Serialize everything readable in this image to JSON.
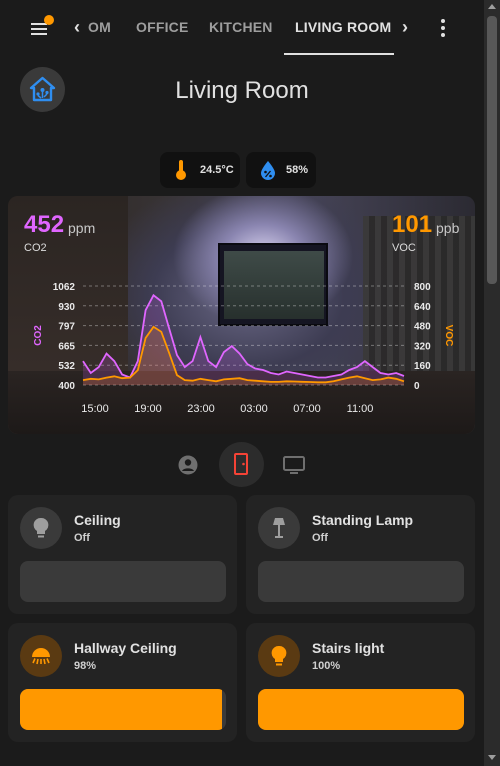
{
  "tabs": {
    "items": [
      {
        "label": "OM"
      },
      {
        "label": "OFFICE"
      },
      {
        "label": "KITCHEN"
      },
      {
        "label": "LIVING ROOM"
      }
    ]
  },
  "page": {
    "title": "Living Room"
  },
  "chips": {
    "temperature": "24.5°C",
    "humidity": "58%"
  },
  "sensors": {
    "co2_value": "452",
    "co2_unit": "ppm",
    "co2_label": "CO2",
    "voc_value": "101",
    "voc_unit": "ppb",
    "voc_label": "VOC"
  },
  "chart_data": {
    "type": "line",
    "x_ticks": [
      "15:00",
      "19:00",
      "23:00",
      "03:00",
      "07:00",
      "11:00"
    ],
    "y_left_ticks": [
      "1062",
      "930",
      "797",
      "665",
      "532",
      "400"
    ],
    "y_right_ticks": [
      "800",
      "640",
      "480",
      "320",
      "160",
      "0"
    ],
    "ylabel_left": "CO2",
    "ylabel_right": "VOC",
    "ylim_left": [
      400,
      1062
    ],
    "ylim_right": [
      0,
      800
    ],
    "series": [
      {
        "name": "CO2",
        "axis": "left",
        "color": "#e066ff",
        "values": [
          560,
          480,
          520,
          610,
          560,
          470,
          450,
          560,
          900,
          1000,
          960,
          780,
          600,
          520,
          560,
          720,
          560,
          520,
          620,
          660,
          610,
          540,
          510,
          500,
          480,
          470,
          490,
          480,
          470,
          460,
          450,
          450,
          460,
          470,
          500,
          520,
          560,
          520,
          480,
          470,
          480,
          460
        ]
      },
      {
        "name": "VOC",
        "axis": "right",
        "color": "#ff9800",
        "values": [
          40,
          50,
          45,
          60,
          70,
          55,
          60,
          120,
          380,
          470,
          430,
          260,
          80,
          40,
          35,
          50,
          40,
          30,
          45,
          50,
          55,
          40,
          35,
          30,
          25,
          25,
          30,
          28,
          26,
          24,
          22,
          22,
          30,
          45,
          60,
          70,
          55,
          40,
          45,
          60,
          50,
          30
        ]
      }
    ],
    "grid": true
  },
  "camera": {
    "grid_lines": true
  },
  "modes": [
    "person-icon",
    "door-icon",
    "tv-icon"
  ],
  "cards": [
    {
      "name": "Ceiling",
      "state": "Off",
      "level": 0,
      "icon": "bulb-icon",
      "on": false
    },
    {
      "name": "Standing Lamp",
      "state": "Off",
      "level": 0,
      "icon": "floor-lamp-icon",
      "on": false
    },
    {
      "name": "Hallway Ceiling",
      "state": "98%",
      "level": 98,
      "icon": "ceiling-light-icon",
      "on": true
    },
    {
      "name": "Stairs light",
      "state": "100%",
      "level": 100,
      "icon": "bulb-icon",
      "on": true
    }
  ],
  "colors": {
    "accent": "#ff9800",
    "co2": "#e066ff",
    "background": "#1b1b1b",
    "card": "#232323"
  }
}
